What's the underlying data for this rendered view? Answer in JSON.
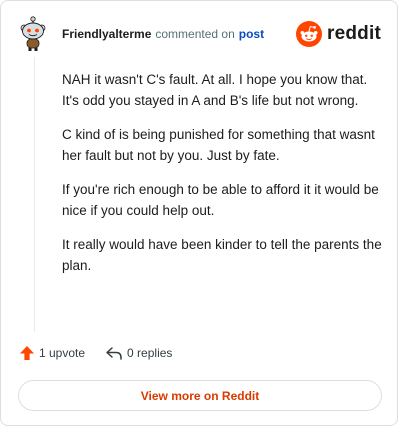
{
  "comment": {
    "username": "Friendlyalterme",
    "action_text": "commented on",
    "post_link": "post",
    "paragraphs": [
      "NAH it wasn't C's fault. At all. I hope you know that. It's odd you stayed in A and B's life but not wrong.",
      "C kind of is being punished for something that wasnt her fault but not by you. Just by fate.",
      "If you're rich enough to be able to afford it it would be nice if you could help out.",
      "It really would have been kinder to tell the parents the plan."
    ]
  },
  "brand": {
    "name": "reddit",
    "icon": "reddit-logo-icon",
    "color": "#ff4500"
  },
  "actions": {
    "upvotes": "1 upvote",
    "replies": "0 replies",
    "upvote_icon": "upvote-arrow-icon",
    "reply_icon": "reply-arrow-icon"
  },
  "footer": {
    "view_more": "View more on Reddit",
    "accent": "#d93a00"
  }
}
